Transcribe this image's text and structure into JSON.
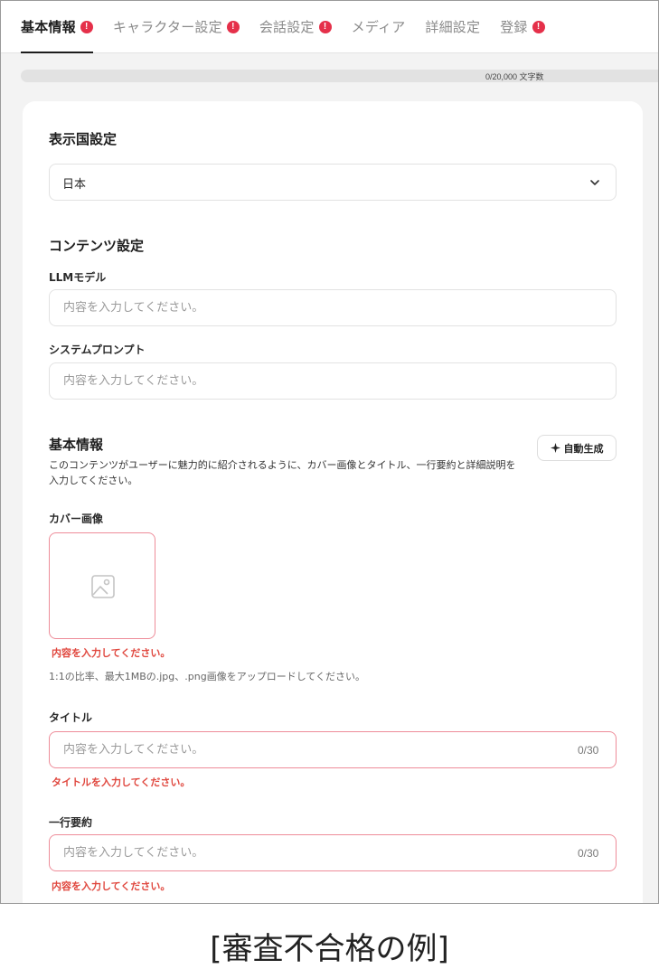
{
  "tabs": [
    {
      "label": "基本情報",
      "alert": "!"
    },
    {
      "label": "キャラクター設定",
      "alert": "!"
    },
    {
      "label": "会話設定",
      "alert": "!"
    },
    {
      "label": "メディア",
      "alert": ""
    },
    {
      "label": "詳細設定",
      "alert": ""
    },
    {
      "label": "登録",
      "alert": "!"
    }
  ],
  "progress": {
    "label": "0/20,000 文字数",
    "value": 0
  },
  "display_country": {
    "title": "表示国設定",
    "selected": "日本"
  },
  "content_settings": {
    "title": "コンテンツ設定",
    "llm_label": "LLMモデル",
    "llm_placeholder": "内容を入力してください。",
    "prompt_label": "システムプロンプト",
    "prompt_placeholder": "内容を入力してください。"
  },
  "basic_info": {
    "title": "基本情報",
    "description": "このコンテンツがユーザーに魅力的に紹介されるように、カバー画像とタイトル、一行要約と詳細説明を入力してください。",
    "auto_button": "自動生成",
    "cover_label": "カバー画像",
    "cover_error": "内容を入力してください。",
    "cover_help": "1:1の比率、最大1MBの.jpg、.png画像をアップロードしてください。",
    "title_label": "タイトル",
    "title_placeholder": "内容を入力してください。",
    "title_counter": "0/30",
    "title_error": "タイトルを入力してください。",
    "summary_label": "一行要約",
    "summary_placeholder": "内容を入力してください。",
    "summary_counter": "0/30",
    "summary_error": "内容を入力してください。"
  },
  "caption": "[審査不合格の例]",
  "colors": {
    "accent": "#1d1d1d",
    "error": "#e0473e",
    "badge": "#e5304a",
    "error_border": "#ee8c99"
  }
}
